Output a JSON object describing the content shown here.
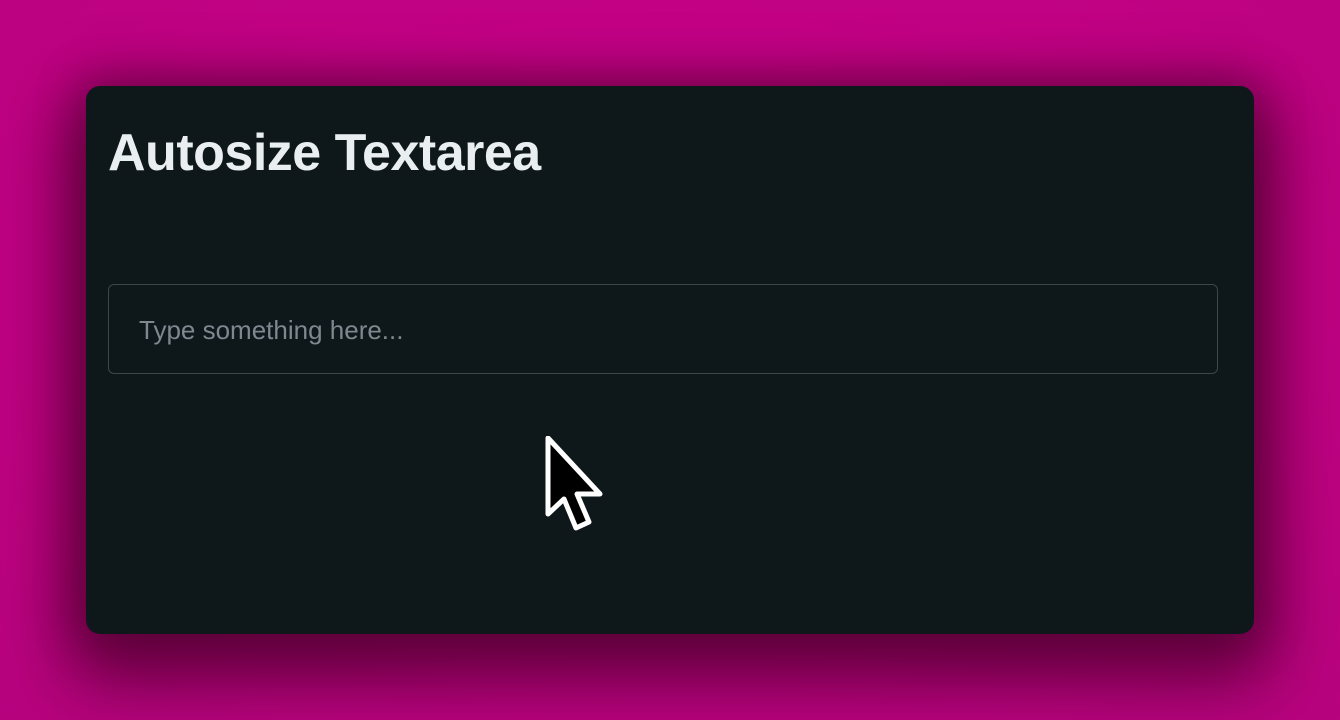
{
  "page": {
    "title": "Autosize Textarea"
  },
  "textarea": {
    "value": "",
    "placeholder": "Type something here..."
  },
  "icons": {
    "pointer": "mouse-pointer-icon"
  },
  "colors": {
    "background": "#c10284",
    "panel": "#0e171a",
    "title_text": "#e9eef1",
    "placeholder_text": "#7d898f",
    "textarea_border": "#3a474d"
  }
}
